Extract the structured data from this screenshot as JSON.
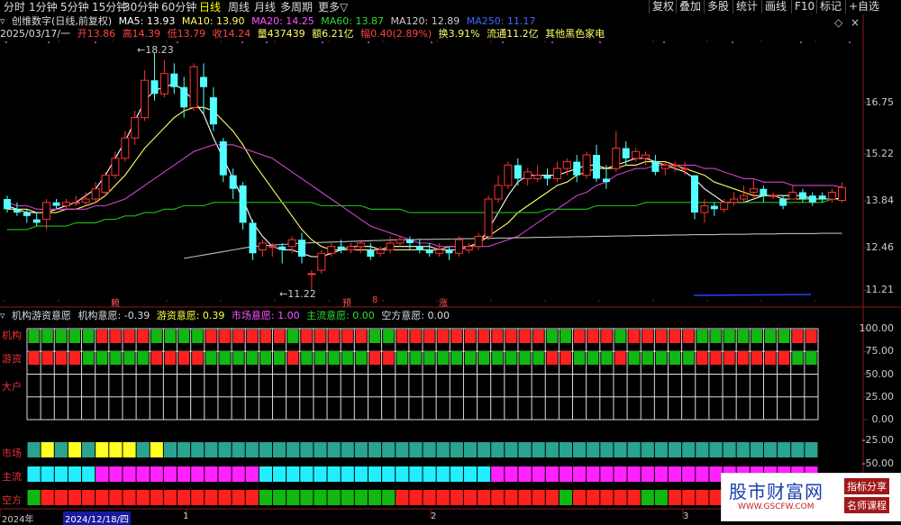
{
  "toolbar": {
    "periods": [
      "分时",
      "1分钟",
      "5分钟",
      "15分钟",
      "30分钟",
      "60分钟",
      "日线",
      "周线",
      "月线",
      "多周期",
      "更多"
    ],
    "active_period": "日线",
    "more_suffix": "▽",
    "buttons": [
      "复权",
      "叠加",
      "多股",
      "统计",
      "画线",
      "F10",
      "标记",
      "+自选"
    ],
    "diamond": "◇",
    "close": "×"
  },
  "info": {
    "stock_name": "创维数字(日线,前复权)",
    "ma5": "MA5: 13.93",
    "ma10": "MA10: 13.90",
    "ma20": "MA20: 14.25",
    "ma60": "MA60: 13.87",
    "ma120": "MA120: 12.89",
    "ma250": "MA250: 11.17",
    "date": "2025/03/17/一",
    "open": "开13.86",
    "high": "高14.39",
    "low": "低13.79",
    "close": "收14.24",
    "volume": "量437439",
    "amount": "额6.21亿",
    "change": "幅0.40(2.89%)",
    "turnover": "换3.91%",
    "float": "流通11.2亿",
    "industry": "其他黑色家电"
  },
  "price_axis": [
    "16.75",
    "15.22",
    "13.84",
    "12.46",
    "11.21"
  ],
  "annotations": {
    "high_label": "18.23",
    "low_label": "11.22",
    "marks": [
      "赖",
      "预",
      "8",
      "涨"
    ]
  },
  "indicator": {
    "title": "机构游资意愿",
    "jigou": "机构意愿: -0.39",
    "youzi": "游资意愿: 0.39",
    "shichang": "市场意愿: 1.00",
    "zhuliu": "主流意愿: 0.00",
    "kongfang": "空方意愿: 0.00",
    "axis": [
      "100.00",
      "75.00",
      "50.00",
      "25.00",
      "0.00",
      "-25.00",
      "-50.00"
    ],
    "rows": [
      "机构",
      "游资",
      "大户",
      "市场",
      "主流",
      "空方"
    ],
    "jigou_pattern": "GGGGGRRRRGGGGRRRRRRGRRRRRGGRRRRRRRRRRRGGRRRGRRRRRGGGGGGGRRRRGGGGGGGGRRRRGGGGRGGGRRGG",
    "youzi_pattern": "RRRRGGGGGRRRRGGGGGGRGGGGGRRGGGGGGGGGGGRRGGGRGGGGGRRRRRRRGGGGRRRRRRRRGGGGRRRRGRRRGGRR",
    "shichang_pattern": "TYTYTYYYTYTTTTTTTTTTTTTTTTTTTTTTTTTTTTTTTTTTTTTTTTTTTTTTTTTTTTTTTTTTTTTTTTTTTTTTTTTT",
    "zhuliu_pattern": "CCCCCMMMMMMMMMMMMCCCCCCCCCCCCCCCCCMMMMMMMMMMMMMMMMMMMMMMMMCCCCMMMMMMMMMMMMCCCCCCCCCCC",
    "kongfang_pattern": "GRRRRRRRRRRRRRRRRGGGGGGGGGGRRRRRRRRRRRRGRRRRRGGRRRRRRRRRRRRRGRRRRRRRRRGGGGGGGGGGGGGG"
  },
  "time_axis": {
    "year": "2024年",
    "cursor_date": "2024/12/18/四",
    "ticks": [
      "1",
      "2",
      "3"
    ]
  },
  "watermark": {
    "main": "股市财富网",
    "url": "WWW.GSCFW.COM",
    "tag1": "指标分享",
    "tag2": "名师课程"
  },
  "chart_data": {
    "type": "candlestick",
    "price_range": [
      10.9,
      18.6
    ],
    "candles": [
      [
        13.9,
        13.6,
        14.0,
        13.5
      ],
      [
        13.6,
        13.5,
        13.8,
        13.4
      ],
      [
        13.5,
        13.4,
        13.6,
        13.2
      ],
      [
        13.3,
        13.2,
        13.5,
        13.1
      ],
      [
        13.3,
        13.8,
        13.9,
        13.0
      ],
      [
        13.8,
        13.7,
        13.9,
        13.6
      ],
      [
        13.7,
        13.8,
        13.9,
        13.6
      ],
      [
        13.8,
        13.8,
        14.0,
        13.7
      ],
      [
        13.8,
        13.9,
        14.1,
        13.7
      ],
      [
        13.9,
        14.2,
        14.4,
        13.8
      ],
      [
        14.1,
        14.6,
        14.7,
        14.0
      ],
      [
        14.6,
        15.1,
        15.3,
        14.5
      ],
      [
        15.1,
        15.7,
        15.9,
        15.0
      ],
      [
        15.7,
        16.3,
        16.5,
        15.5
      ],
      [
        16.3,
        17.4,
        17.7,
        16.2
      ],
      [
        17.4,
        17.0,
        18.2,
        16.8
      ],
      [
        17.0,
        17.6,
        18.0,
        16.9
      ],
      [
        17.6,
        17.2,
        17.9,
        17.0
      ],
      [
        17.2,
        16.6,
        17.5,
        16.3
      ],
      [
        16.6,
        17.8,
        17.9,
        16.5
      ],
      [
        17.5,
        17.2,
        17.9,
        16.4
      ],
      [
        16.9,
        16.1,
        17.2,
        15.9
      ],
      [
        15.6,
        14.6,
        15.7,
        14.4
      ],
      [
        14.6,
        14.2,
        14.8,
        13.9
      ],
      [
        14.3,
        13.2,
        14.4,
        13.0
      ],
      [
        13.2,
        12.3,
        13.3,
        12.1
      ],
      [
        12.4,
        12.6,
        12.7,
        12.2
      ],
      [
        12.5,
        12.5,
        12.6,
        12.2
      ],
      [
        12.5,
        12.4,
        12.6,
        12.0
      ],
      [
        12.5,
        12.7,
        12.8,
        12.3
      ],
      [
        12.7,
        12.2,
        12.9,
        12.0
      ],
      [
        11.7,
        11.7,
        11.8,
        11.2
      ],
      [
        11.8,
        12.3,
        12.4,
        11.7
      ],
      [
        12.3,
        12.5,
        12.6,
        12.2
      ],
      [
        12.5,
        12.4,
        12.7,
        12.3
      ],
      [
        12.4,
        12.5,
        12.6,
        12.3
      ],
      [
        12.5,
        12.6,
        12.7,
        12.3
      ],
      [
        12.4,
        12.2,
        12.6,
        12.1
      ],
      [
        12.3,
        12.4,
        12.5,
        12.2
      ],
      [
        12.4,
        12.6,
        12.8,
        12.3
      ],
      [
        12.6,
        12.7,
        12.8,
        12.5
      ],
      [
        12.7,
        12.6,
        12.8,
        12.4
      ],
      [
        12.5,
        12.4,
        12.7,
        12.3
      ],
      [
        12.4,
        12.3,
        12.6,
        12.2
      ],
      [
        12.3,
        12.4,
        12.6,
        12.2
      ],
      [
        12.4,
        12.3,
        12.5,
        12.1
      ],
      [
        12.3,
        12.7,
        12.8,
        12.2
      ],
      [
        12.4,
        12.5,
        12.6,
        12.3
      ],
      [
        12.5,
        12.8,
        12.9,
        12.4
      ],
      [
        12.8,
        13.9,
        14.0,
        12.7
      ],
      [
        13.9,
        14.3,
        14.6,
        13.8
      ],
      [
        14.3,
        14.9,
        15.0,
        14.2
      ],
      [
        14.9,
        14.5,
        15.1,
        14.3
      ],
      [
        14.5,
        14.7,
        14.8,
        14.3
      ],
      [
        14.5,
        14.6,
        14.9,
        14.4
      ],
      [
        14.6,
        14.5,
        14.8,
        14.3
      ],
      [
        14.5,
        14.8,
        15.0,
        14.4
      ],
      [
        14.8,
        15.0,
        15.1,
        14.6
      ],
      [
        15.0,
        14.6,
        15.2,
        14.4
      ],
      [
        14.6,
        15.2,
        15.3,
        14.5
      ],
      [
        15.2,
        14.5,
        15.5,
        14.4
      ],
      [
        14.5,
        14.4,
        14.9,
        14.2
      ],
      [
        14.8,
        15.4,
        15.9,
        14.7
      ],
      [
        15.4,
        15.1,
        15.6,
        14.9
      ],
      [
        15.1,
        15.3,
        15.4,
        15.0
      ],
      [
        15.1,
        15.2,
        15.3,
        14.9
      ],
      [
        15.0,
        14.7,
        15.2,
        14.6
      ],
      [
        14.8,
        14.9,
        15.0,
        14.6
      ],
      [
        14.9,
        14.9,
        15.0,
        14.7
      ],
      [
        14.8,
        14.8,
        15.0,
        14.6
      ],
      [
        14.6,
        13.5,
        14.6,
        13.3
      ],
      [
        13.5,
        13.7,
        13.9,
        13.2
      ],
      [
        13.7,
        13.6,
        13.8,
        13.4
      ],
      [
        13.6,
        13.8,
        13.9,
        13.5
      ],
      [
        13.8,
        13.9,
        14.1,
        13.7
      ],
      [
        13.9,
        14.0,
        14.3,
        13.8
      ],
      [
        14.1,
        14.2,
        14.5,
        13.9
      ],
      [
        14.2,
        14.0,
        14.3,
        13.8
      ],
      [
        14.0,
        14.0,
        14.1,
        13.9
      ],
      [
        13.9,
        13.7,
        14.0,
        13.6
      ],
      [
        13.9,
        14.1,
        14.3,
        13.9
      ],
      [
        14.1,
        13.9,
        14.2,
        13.8
      ],
      [
        14.0,
        13.8,
        14.1,
        13.7
      ],
      [
        14.0,
        13.9,
        14.1,
        13.8
      ],
      [
        13.9,
        14.1,
        14.2,
        13.8
      ],
      [
        13.86,
        14.24,
        14.39,
        13.79
      ]
    ],
    "lines": {
      "ma5": [
        13.7,
        13.6,
        13.5,
        13.5,
        13.5,
        13.6,
        13.7,
        13.8,
        14.0,
        14.2,
        14.6,
        15.1,
        15.6,
        16.2,
        16.8,
        17.1,
        17.2,
        17.3,
        17.1,
        16.8,
        16.4,
        15.7,
        15.1,
        14.5,
        13.9,
        13.2,
        12.8,
        12.5,
        12.4,
        12.4,
        12.3,
        12.2,
        12.2,
        12.3,
        12.4,
        12.5,
        12.5,
        12.5,
        12.4,
        12.5,
        12.5,
        12.5,
        12.5,
        12.5,
        12.4,
        12.4,
        12.4,
        12.5,
        12.6,
        13.0,
        13.5,
        14.0,
        14.4,
        14.6,
        14.6,
        14.6,
        14.6,
        14.7,
        14.8,
        14.9,
        14.9,
        14.8,
        14.9,
        15.0,
        15.1,
        15.1,
        15.0,
        14.9,
        14.8,
        14.7,
        14.5,
        14.2,
        14.0,
        13.8,
        13.8,
        13.8,
        13.9,
        14.0,
        14.0,
        14.0,
        14.0,
        14.0,
        13.9,
        13.9,
        13.9,
        13.93
      ],
      "ma10": [
        13.6,
        13.6,
        13.6,
        13.5,
        13.5,
        13.5,
        13.6,
        13.6,
        13.7,
        13.8,
        14.0,
        14.3,
        14.6,
        15.0,
        15.4,
        15.7,
        16.0,
        16.3,
        16.5,
        16.6,
        16.6,
        16.5,
        16.2,
        15.9,
        15.5,
        15.0,
        14.6,
        14.2,
        13.8,
        13.4,
        13.0,
        12.7,
        12.5,
        12.4,
        12.4,
        12.4,
        12.4,
        12.4,
        12.4,
        12.4,
        12.4,
        12.4,
        12.4,
        12.4,
        12.4,
        12.5,
        12.5,
        12.5,
        12.6,
        12.8,
        13.0,
        13.2,
        13.5,
        13.7,
        13.9,
        14.1,
        14.3,
        14.4,
        14.6,
        14.7,
        14.8,
        14.8,
        14.8,
        14.9,
        14.9,
        15.0,
        15.0,
        15.0,
        14.9,
        14.8,
        14.7,
        14.6,
        14.4,
        14.3,
        14.2,
        14.1,
        14.0,
        14.0,
        14.0,
        13.9,
        13.9,
        13.9,
        13.9,
        13.9,
        13.9,
        13.9
      ],
      "ma20": [
        13.8,
        13.7,
        13.7,
        13.6,
        13.6,
        13.6,
        13.6,
        13.6,
        13.6,
        13.7,
        13.7,
        13.8,
        13.9,
        14.1,
        14.3,
        14.5,
        14.7,
        14.9,
        15.1,
        15.3,
        15.4,
        15.5,
        15.5,
        15.5,
        15.4,
        15.3,
        15.2,
        15.1,
        14.9,
        14.7,
        14.5,
        14.3,
        14.1,
        13.9,
        13.7,
        13.5,
        13.3,
        13.1,
        13.0,
        12.9,
        12.8,
        12.7,
        12.6,
        12.6,
        12.5,
        12.5,
        12.5,
        12.5,
        12.5,
        12.5,
        12.6,
        12.7,
        12.8,
        13.0,
        13.2,
        13.4,
        13.6,
        13.8,
        14.0,
        14.1,
        14.3,
        14.4,
        14.6,
        14.7,
        14.8,
        14.8,
        14.9,
        14.9,
        14.9,
        14.9,
        14.9,
        14.8,
        14.8,
        14.7,
        14.6,
        14.5,
        14.5,
        14.4,
        14.4,
        14.4,
        14.3,
        14.3,
        14.3,
        14.3,
        14.3,
        14.25
      ],
      "ma60": [
        13.0,
        13.0,
        13.0,
        13.1,
        13.1,
        13.1,
        13.1,
        13.2,
        13.2,
        13.2,
        13.3,
        13.3,
        13.4,
        13.4,
        13.5,
        13.5,
        13.6,
        13.6,
        13.7,
        13.7,
        13.7,
        13.8,
        13.8,
        13.8,
        13.8,
        13.8,
        13.8,
        13.8,
        13.8,
        13.8,
        13.8,
        13.8,
        13.7,
        13.7,
        13.7,
        13.7,
        13.7,
        13.6,
        13.6,
        13.6,
        13.6,
        13.5,
        13.5,
        13.5,
        13.5,
        13.5,
        13.5,
        13.5,
        13.5,
        13.5,
        13.5,
        13.5,
        13.5,
        13.5,
        13.5,
        13.6,
        13.6,
        13.6,
        13.6,
        13.6,
        13.7,
        13.7,
        13.7,
        13.7,
        13.7,
        13.8,
        13.8,
        13.8,
        13.8,
        13.8,
        13.8,
        13.8,
        13.8,
        13.8,
        13.8,
        13.8,
        13.8,
        13.8,
        13.8,
        13.8,
        13.8,
        13.8,
        13.8,
        13.8,
        13.9,
        13.87
      ],
      "ma120": [
        11.3,
        11.3,
        11.35,
        11.4,
        11.45,
        11.5,
        11.55,
        11.6,
        11.65,
        11.7,
        11.75,
        11.8,
        11.85,
        11.9,
        11.95,
        12.0,
        12.05,
        12.1,
        12.15,
        12.2,
        12.25,
        12.3,
        12.35,
        12.4,
        12.45,
        12.5,
        12.52,
        12.54,
        12.56,
        12.58,
        12.6,
        12.61,
        12.62,
        12.63,
        12.64,
        12.65,
        12.66,
        12.67,
        12.68,
        12.69,
        12.7,
        12.7,
        12.71,
        12.71,
        12.72,
        12.72,
        12.73,
        12.73,
        12.74,
        12.74,
        12.75,
        12.75,
        12.76,
        12.76,
        12.77,
        12.77,
        12.78,
        12.78,
        12.79,
        12.79,
        12.8,
        12.8,
        12.81,
        12.81,
        12.82,
        12.82,
        12.83,
        12.83,
        12.84,
        12.84,
        12.85,
        12.85,
        12.85,
        12.86,
        12.86,
        12.86,
        12.87,
        12.87,
        12.87,
        12.88,
        12.88,
        12.88,
        12.88,
        12.89,
        12.89,
        12.89
      ]
    }
  }
}
